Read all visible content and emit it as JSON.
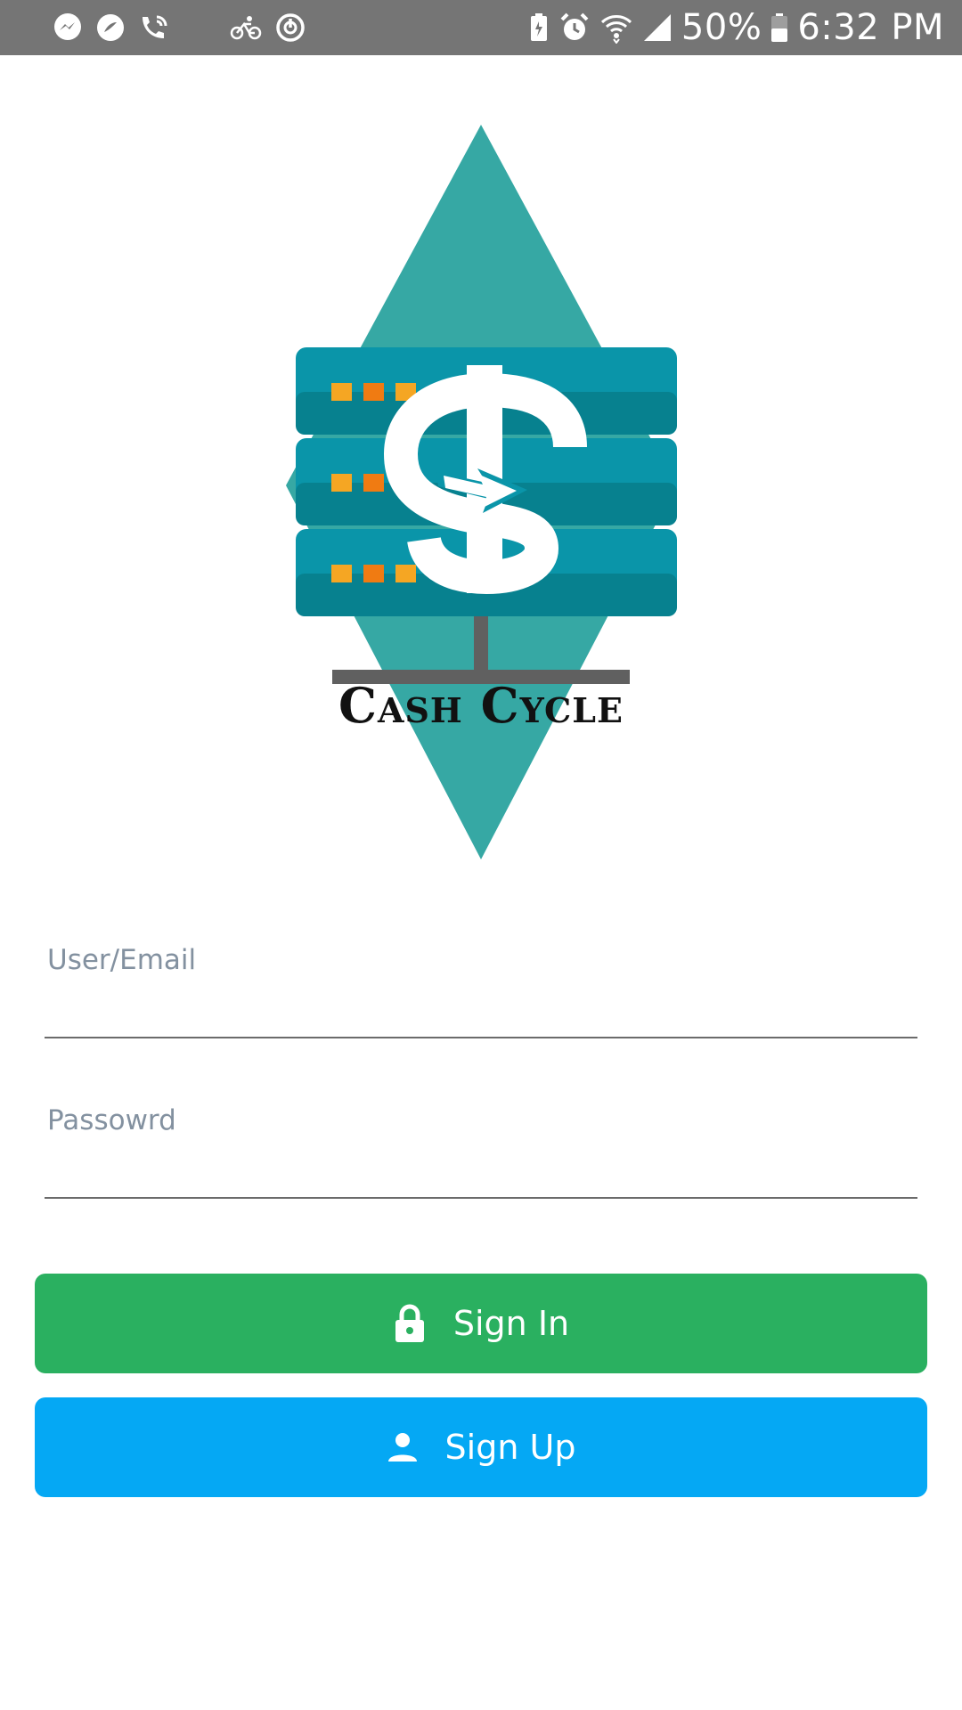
{
  "status_bar": {
    "battery_percent": "50%",
    "time": "6:32 PM",
    "left_icons": [
      "messenger-icon",
      "data-saver-icon",
      "wifi-call-icon",
      "bike-icon",
      "power-timer-icon"
    ],
    "right_icons": [
      "battery-saver-icon",
      "alarm-icon",
      "wifi-icon",
      "signal-icon",
      "battery-icon"
    ]
  },
  "logo": {
    "text": "Cash Cycle",
    "colors": {
      "diamond": "#36a8a4",
      "server": "#0a95a9",
      "server_dark": "#07818f",
      "dot_orange": "#f5a623",
      "dot_dark": "#f07b12",
      "stand": "#606060"
    }
  },
  "form": {
    "user_label": "User/Email",
    "user_value": "",
    "password_label": "Passowrd",
    "password_value": ""
  },
  "buttons": {
    "sign_in": "Sign In",
    "sign_up": "Sign Up",
    "sign_in_icon": "lock-icon",
    "sign_up_icon": "person-icon"
  },
  "colors": {
    "sign_in_bg": "#2ab060",
    "sign_up_bg": "#05a8f4",
    "status_bar_bg": "#757575"
  }
}
